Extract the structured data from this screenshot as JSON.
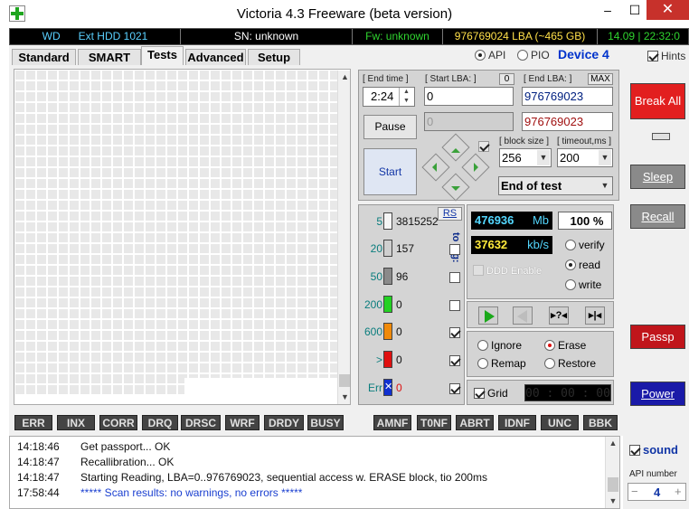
{
  "window": {
    "title": "Victoria 4.3 Freeware (beta version)",
    "min": "–",
    "max": "☐",
    "close": "✕"
  },
  "infobar": {
    "model": "WD      Ext HDD 1021",
    "serial": "SN: unknown",
    "firmware": "Fw: unknown",
    "lba": "976769024 LBA (~465 GB)",
    "datetime": "14.09 | 22:32:0"
  },
  "tabs": [
    "Standard",
    "SMART",
    "Tests",
    "Advanced",
    "Setup"
  ],
  "access": {
    "api": "API",
    "pio": "PIO",
    "device": "Device 4",
    "hints": "Hints"
  },
  "controls": {
    "end_time_label": "[ End time ]",
    "end_time": "2:24",
    "start_lba_label": "[ Start LBA: ]",
    "zero": "0",
    "start_lba": "0",
    "start_lba2": "0",
    "end_lba_label": "[ End LBA: ]",
    "max": "MAX",
    "end_lba": "976769023",
    "end_lba2": "976769023",
    "pause": "Pause",
    "start": "Start",
    "block_size_label": "[ block size ]",
    "block_size": "256",
    "timeout_label": "[ timeout,ms ]",
    "timeout": "200",
    "end_action": "End of test"
  },
  "stats": {
    "rs": "RS",
    "to_log": "to log:",
    "rows": [
      {
        "ms": "5",
        "count": "3815252",
        "color": "#f5f5f5"
      },
      {
        "ms": "20",
        "count": "157",
        "color": "#cfcfcf"
      },
      {
        "ms": "50",
        "count": "96",
        "color": "#8a8a8a"
      },
      {
        "ms": "200",
        "count": "0",
        "color": "#23d123"
      },
      {
        "ms": "600",
        "count": "0",
        "color": "#f08a0a"
      },
      {
        "ms": ">",
        "count": "0",
        "color": "#e01010"
      },
      {
        "ms": "Err",
        "count": "0",
        "color": "#1030d0"
      }
    ]
  },
  "speed": {
    "mb": "476936",
    "mb_unit": "Mb",
    "percent": "100",
    "percent_unit": "%",
    "kbs": "37632",
    "kbs_unit": "kb/s",
    "ddd": "DDD Enable",
    "verify": "verify",
    "read": "read",
    "write": "write"
  },
  "actions": {
    "ignore": "Ignore",
    "erase": "Erase",
    "remap": "Remap",
    "restore": "Restore",
    "grid": "Grid",
    "timer": "00 : 00 : 00"
  },
  "right": {
    "break_all": "Break All",
    "sleep": "Sleep",
    "recall": "Recall",
    "passp": "Passp",
    "power": "Power",
    "sound": "sound",
    "api_number_label": "API number",
    "api_number": "4"
  },
  "errflags": [
    "ERR",
    "INX",
    "CORR",
    "DRQ",
    "DRSC",
    "WRF",
    "DRDY",
    "BUSY",
    "AMNF",
    "T0NF",
    "ABRT",
    "IDNF",
    "UNC",
    "BBK"
  ],
  "log": [
    {
      "time": "14:18:46",
      "msg": "Get passport... OK",
      "color": "#111"
    },
    {
      "time": "14:18:47",
      "msg": "Recallibration... OK",
      "color": "#111"
    },
    {
      "time": "14:18:47",
      "msg": "Starting Reading, LBA=0..976769023, sequential access w. ERASE block, tio 200ms",
      "color": "#111"
    },
    {
      "time": "17:58:44",
      "msg": "***** Scan results: no warnings, no errors *****",
      "color": "#1a3fd0"
    }
  ]
}
